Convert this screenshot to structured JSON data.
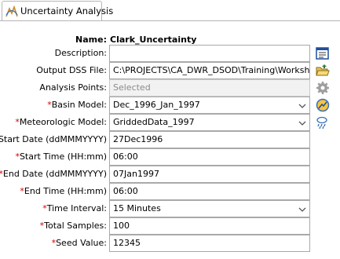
{
  "tab": {
    "label": "Uncertainty Analysis",
    "icon": "uncertainty-analysis-icon"
  },
  "form": {
    "name_label": "Name:",
    "name_value": "Clark_Uncertainty",
    "description": {
      "label": "Description:",
      "value": ""
    },
    "output_dss": {
      "label": "Output DSS File:",
      "value": "C:\\PROJECTS\\CA_DWR_DSOD\\Training\\Workshops\\"
    },
    "analysis_points": {
      "label": "Analysis Points:",
      "value": "Selected"
    },
    "basin_model": {
      "req": "*",
      "label": "Basin Model:",
      "value": "Dec_1996_Jan_1997"
    },
    "met_model": {
      "req": "*",
      "label": "Meteorologic Model:",
      "value": "GriddedData_1997"
    },
    "start_date": {
      "req": "*",
      "label": "Start Date (ddMMMYYYY)",
      "value": "27Dec1996"
    },
    "start_time": {
      "req": "*",
      "label": "Start Time (HH:mm)",
      "value": "06:00"
    },
    "end_date": {
      "req": "*",
      "label": "End Date (ddMMMYYYY)",
      "value": "07Jan1997"
    },
    "end_time": {
      "req": "*",
      "label": "End Time (HH:mm)",
      "value": "06:00"
    },
    "time_interval": {
      "req": "*",
      "label": "Time Interval:",
      "value": "15 Minutes"
    },
    "total_samples": {
      "req": "*",
      "label": "Total Samples:",
      "value": "100"
    },
    "seed_value": {
      "req": "*",
      "label": "Seed Value:",
      "value": "12345"
    }
  }
}
